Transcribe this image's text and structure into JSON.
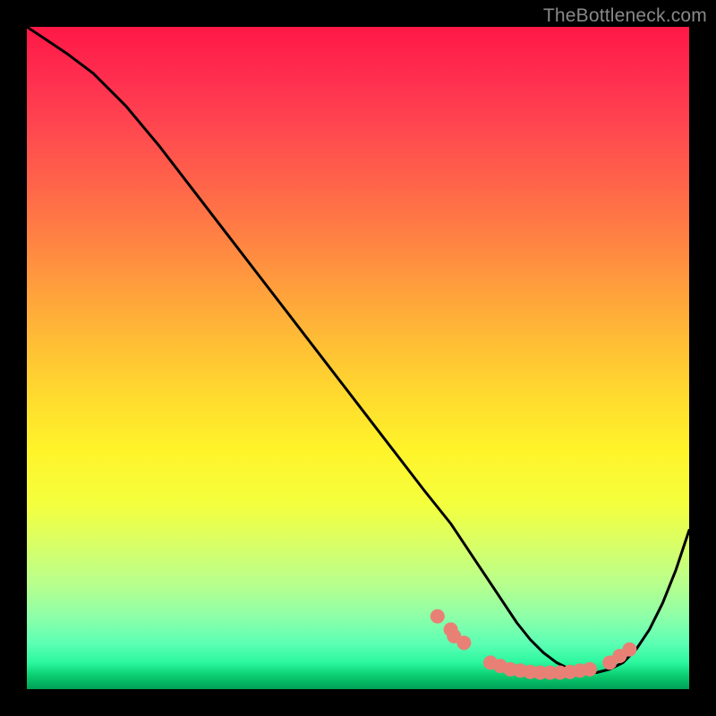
{
  "watermark": "TheBottleneck.com",
  "chart_data": {
    "type": "line",
    "title": "",
    "xlabel": "",
    "ylabel": "",
    "xlim": [
      0,
      100
    ],
    "ylim": [
      0,
      100
    ],
    "grid": false,
    "legend": false,
    "series": [
      {
        "name": "curve",
        "color": "#000000",
        "x": [
          0,
          3,
          6,
          10,
          15,
          20,
          25,
          30,
          35,
          40,
          45,
          50,
          55,
          60,
          62,
          64,
          66,
          68,
          70,
          72,
          74,
          76,
          78,
          80,
          82,
          84,
          86,
          88,
          90,
          92,
          94,
          96,
          98,
          100
        ],
        "y": [
          100,
          98,
          96,
          93,
          88,
          82,
          75.5,
          69,
          62.5,
          56,
          49.5,
          43,
          36.5,
          30,
          27.5,
          25,
          22,
          19,
          16,
          13,
          10,
          7.5,
          5.5,
          4,
          3,
          2.5,
          2.5,
          3,
          4,
          6,
          9,
          13,
          18,
          24
        ]
      }
    ],
    "markers": [
      {
        "name": "highlight-dots",
        "color": "#e88076",
        "radius_px": 8,
        "points": [
          {
            "x": 62,
            "y": 11
          },
          {
            "x": 64,
            "y": 9
          },
          {
            "x": 64.5,
            "y": 8
          },
          {
            "x": 66,
            "y": 7
          },
          {
            "x": 70,
            "y": 4
          },
          {
            "x": 71.5,
            "y": 3.5
          },
          {
            "x": 73,
            "y": 3
          },
          {
            "x": 74.5,
            "y": 2.8
          },
          {
            "x": 76,
            "y": 2.6
          },
          {
            "x": 77.5,
            "y": 2.5
          },
          {
            "x": 79,
            "y": 2.5
          },
          {
            "x": 80.5,
            "y": 2.5
          },
          {
            "x": 82,
            "y": 2.6
          },
          {
            "x": 83.5,
            "y": 2.8
          },
          {
            "x": 85,
            "y": 3
          },
          {
            "x": 88,
            "y": 4
          },
          {
            "x": 89.5,
            "y": 5
          },
          {
            "x": 91,
            "y": 6
          }
        ]
      }
    ]
  }
}
